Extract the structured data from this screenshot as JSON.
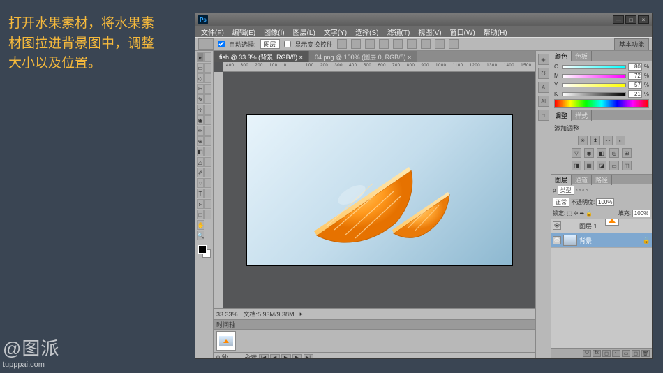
{
  "instruction_text": "打开水果素材，将水果素材图拉进背景图中，调整大小以及位置。",
  "watermark": {
    "logo": "@图派",
    "url": "tupppai.com"
  },
  "titlebar": {
    "logo": "Ps"
  },
  "window_buttons": {
    "min": "—",
    "max": "□",
    "close": "×"
  },
  "menubar": [
    "文件(F)",
    "编辑(E)",
    "图像(I)",
    "图层(L)",
    "文字(Y)",
    "选择(S)",
    "滤镜(T)",
    "视图(V)",
    "窗口(W)",
    "帮助(H)"
  ],
  "optbar": {
    "auto_select": "自动选择:",
    "group": "图层",
    "show_controls": "显示变换控件",
    "right": "基本功能"
  },
  "tabs": [
    {
      "label": "fish @ 33.3% (背景, RGB/8) ×",
      "active": true
    },
    {
      "label": "04.png @ 100% (图层 0, RGB/8) ×",
      "active": false
    }
  ],
  "statusbar": {
    "zoom": "33.33%",
    "docinfo": "文档:5.93M/9.38M"
  },
  "timeline": {
    "tab": "时间轴",
    "duration": "0 秒",
    "loop": "永远"
  },
  "color_panel": {
    "tabs": [
      "颜色",
      "色板"
    ],
    "channels": [
      {
        "l": "C",
        "v": "80"
      },
      {
        "l": "M",
        "v": "72"
      },
      {
        "l": "Y",
        "v": "57"
      },
      {
        "l": "K",
        "v": "21"
      }
    ]
  },
  "adjust_panel": {
    "tabs": [
      "调整",
      "样式"
    ],
    "title": "添加调整"
  },
  "layers_panel": {
    "tabs": [
      "图层",
      "通道",
      "路径"
    ],
    "kind_label": "类型",
    "blend": "正常",
    "opacity_label": "不透明度:",
    "opacity": "100%",
    "lock_label": "锁定:",
    "fill_label": "填充:",
    "fill": "100%",
    "layers": [
      {
        "name": "图层 1",
        "sel": false,
        "thumb": "orange"
      },
      {
        "name": "背景",
        "sel": true,
        "thumb": "grad",
        "locked": true
      }
    ]
  },
  "dock_icons": [
    "◈",
    "℧",
    "A",
    "Al",
    "□"
  ]
}
